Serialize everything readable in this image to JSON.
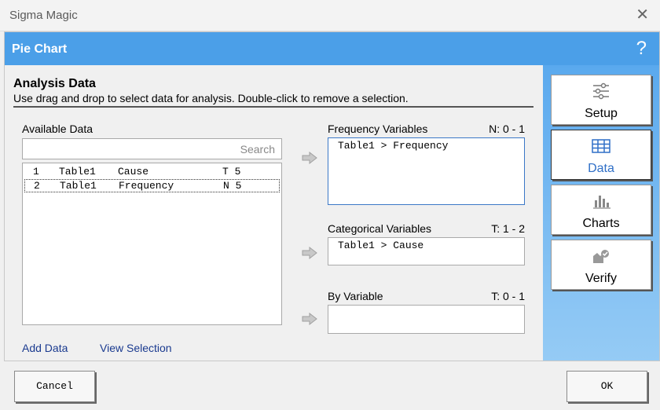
{
  "window": {
    "title": "Sigma Magic",
    "close_icon": "close-icon"
  },
  "header": {
    "title": "Pie Chart",
    "help_label": "?"
  },
  "main": {
    "title": "Analysis Data",
    "description": "Use drag and drop to select data for analysis. Double-click to remove a selection.",
    "available": {
      "label": "Available Data",
      "search_placeholder": "Search",
      "items": [
        {
          "index": "1",
          "table": "Table1",
          "name": "Cause",
          "type": "T 5",
          "selected": false
        },
        {
          "index": "2",
          "table": "Table1",
          "name": "Frequency",
          "type": "N 5",
          "selected": true
        }
      ]
    },
    "frequency": {
      "label": "Frequency Variables",
      "limit": "N: 0 - 1",
      "value": "Table1 > Frequency"
    },
    "categorical": {
      "label": "Categorical Variables",
      "limit": "T: 1 - 2",
      "value": "Table1 > Cause"
    },
    "by_variable": {
      "label": "By Variable",
      "limit": "T: 0 - 1",
      "value": ""
    },
    "links": {
      "add_data": "Add Data",
      "view_selection": "View Selection"
    }
  },
  "sidebar": {
    "items": [
      {
        "label": "Setup",
        "icon": "sliders-icon",
        "active": false
      },
      {
        "label": "Data",
        "icon": "table-icon",
        "active": true
      },
      {
        "label": "Charts",
        "icon": "bar-chart-icon",
        "active": false
      },
      {
        "label": "Verify",
        "icon": "verify-icon",
        "active": false
      }
    ]
  },
  "footer": {
    "cancel_label": "Cancel",
    "ok_label": "OK"
  },
  "colors": {
    "header": "#4b9fe8",
    "sidebar": "#5aa9ee",
    "active_nav": "#2f6fc7",
    "link": "#1a3a8f"
  }
}
